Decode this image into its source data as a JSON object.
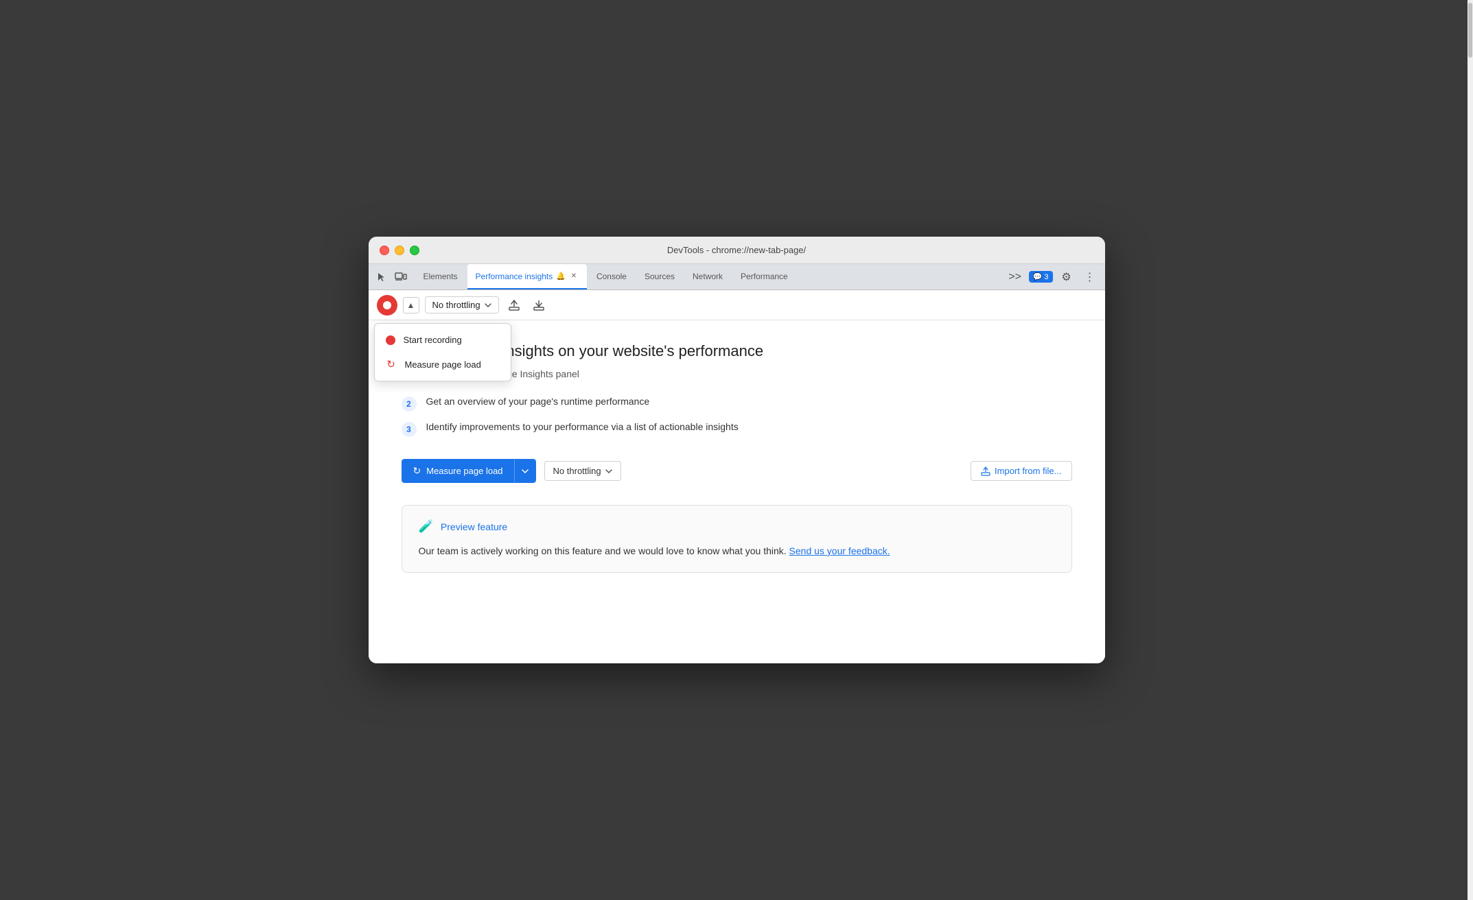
{
  "window": {
    "title": "DevTools - chrome://new-tab-page/"
  },
  "tabs": {
    "items": [
      {
        "id": "elements",
        "label": "Elements",
        "active": false,
        "closeable": false
      },
      {
        "id": "performance-insights",
        "label": "Performance insights",
        "active": true,
        "closeable": true
      },
      {
        "id": "console",
        "label": "Console",
        "active": false,
        "closeable": false
      },
      {
        "id": "sources",
        "label": "Sources",
        "active": false,
        "closeable": false
      },
      {
        "id": "network",
        "label": "Network",
        "active": false,
        "closeable": false
      },
      {
        "id": "performance",
        "label": "Performance",
        "active": false,
        "closeable": false
      }
    ],
    "more_label": ">>",
    "badge_icon": "💬",
    "badge_count": "3"
  },
  "toolbar": {
    "throttle_label": "No throttling",
    "expand_icon": "▲"
  },
  "dropdown": {
    "start_recording_label": "Start recording",
    "measure_page_load_label": "Measure page load"
  },
  "main": {
    "title": "Get actionable insights on your website's performance",
    "subtitle": "Trace into the Performance Insights panel",
    "steps": [
      {
        "number": "2",
        "text": "Get an overview of your page's runtime performance"
      },
      {
        "number": "3",
        "text": "Identify improvements to your performance via a list of actionable insights"
      }
    ],
    "measure_btn_label": "Measure page load",
    "throttle_main_label": "No throttling",
    "import_btn_label": "Import from file...",
    "preview_feature": {
      "title": "Preview feature",
      "text": "Our team is actively working on this feature and we would love to know what you think.",
      "feedback_link_text": "Send us your feedback."
    }
  }
}
